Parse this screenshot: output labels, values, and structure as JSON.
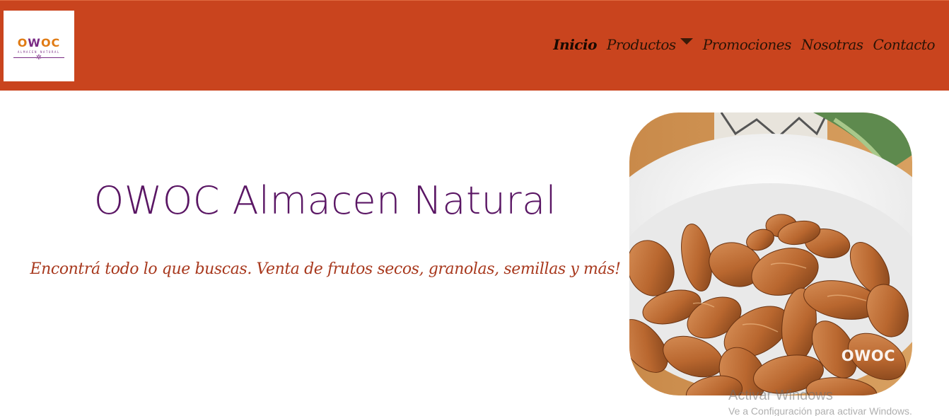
{
  "header": {
    "logo": {
      "text_o1": "O",
      "text_w": "W",
      "text_oc": "OC",
      "subtitle": "ALMACEN NATURAL"
    },
    "nav": [
      {
        "label": "Inicio",
        "active": true
      },
      {
        "label": "Productos",
        "dropdown": true
      },
      {
        "label": "Promociones"
      },
      {
        "label": "Nosotras"
      },
      {
        "label": "Contacto"
      }
    ]
  },
  "hero": {
    "title": "OWOC Almacen Natural",
    "subtitle": "Encontrá todo lo que buscas. Venta de frutos secos, granolas, semillas y más!",
    "image_brand": "OWOC"
  },
  "watermark": {
    "title": "Activar Windows",
    "subtitle": "Ve a Configuración para activar Windows."
  },
  "colors": {
    "header_bg": "#c9441e",
    "title": "#5a1664",
    "subtitle": "#a8391e",
    "logo_orange": "#e07b14",
    "logo_purple": "#7a2b84"
  }
}
